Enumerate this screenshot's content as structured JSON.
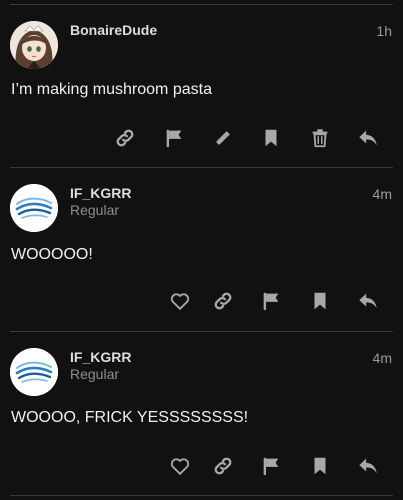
{
  "posts": [
    {
      "username": "BonaireDude",
      "subtitle": "",
      "time": "1h",
      "body": "I’m making mushroom pasta",
      "avatar": "anime-girl-avatar",
      "actions": [
        "link-icon",
        "flag-icon",
        "pencil-icon",
        "bookmark-icon",
        "trash-icon",
        "reply-icon"
      ]
    },
    {
      "username": "IF_KGRR",
      "subtitle": "Regular",
      "time": "4m",
      "body": "WOOOOO!",
      "avatar": "wave-logo-avatar",
      "actions": [
        "heart-icon",
        "link-icon",
        "flag-icon",
        "bookmark-icon",
        "reply-icon"
      ]
    },
    {
      "username": "IF_KGRR",
      "subtitle": "Regular",
      "time": "4m",
      "body": "WOOOO, FRICK YESSSSSSSS!",
      "avatar": "wave-logo-avatar",
      "actions": [
        "heart-icon",
        "link-icon",
        "flag-icon",
        "bookmark-icon",
        "reply-icon"
      ]
    }
  ],
  "colors": {
    "background": "#111111",
    "icon": "#a8a8a8",
    "divider": "#3a3a3a",
    "logo_blue": "#2a7fc0"
  }
}
